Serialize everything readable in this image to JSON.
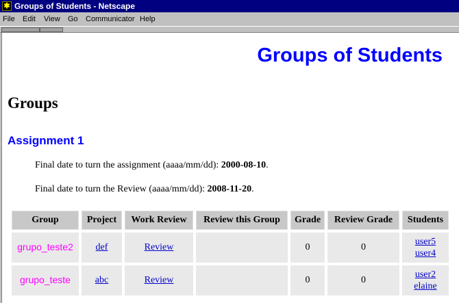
{
  "window": {
    "title": "Groups of Students - Netscape"
  },
  "menu": [
    "File",
    "Edit",
    "View",
    "Go",
    "Communicator",
    "Help"
  ],
  "page": {
    "banner": "Groups of Students",
    "heading": "Groups",
    "assignment_title": "Assignment 1",
    "final_date_label": "Final date to turn the assignment (aaaa/mm/dd):",
    "final_date_value": "2000-08-10",
    "review_date_label": "Final date to turn the Review (aaaa/mm/dd):",
    "review_date_value": "2008-11-20"
  },
  "table": {
    "headers": [
      "Group",
      "Project",
      "Work Review",
      "Review this Group",
      "Grade",
      "Review Grade",
      "Students"
    ],
    "rows": [
      {
        "group": "grupo_teste2",
        "project": "def",
        "work_review": "Review",
        "review_group": "",
        "grade": "0",
        "review_grade": "0",
        "students": [
          "user5",
          "user4"
        ]
      },
      {
        "group": "grupo_teste",
        "project": "abc",
        "work_review": "Review",
        "review_group": "",
        "grade": "0",
        "review_grade": "0",
        "students": [
          "user2",
          "elaine"
        ]
      }
    ]
  }
}
